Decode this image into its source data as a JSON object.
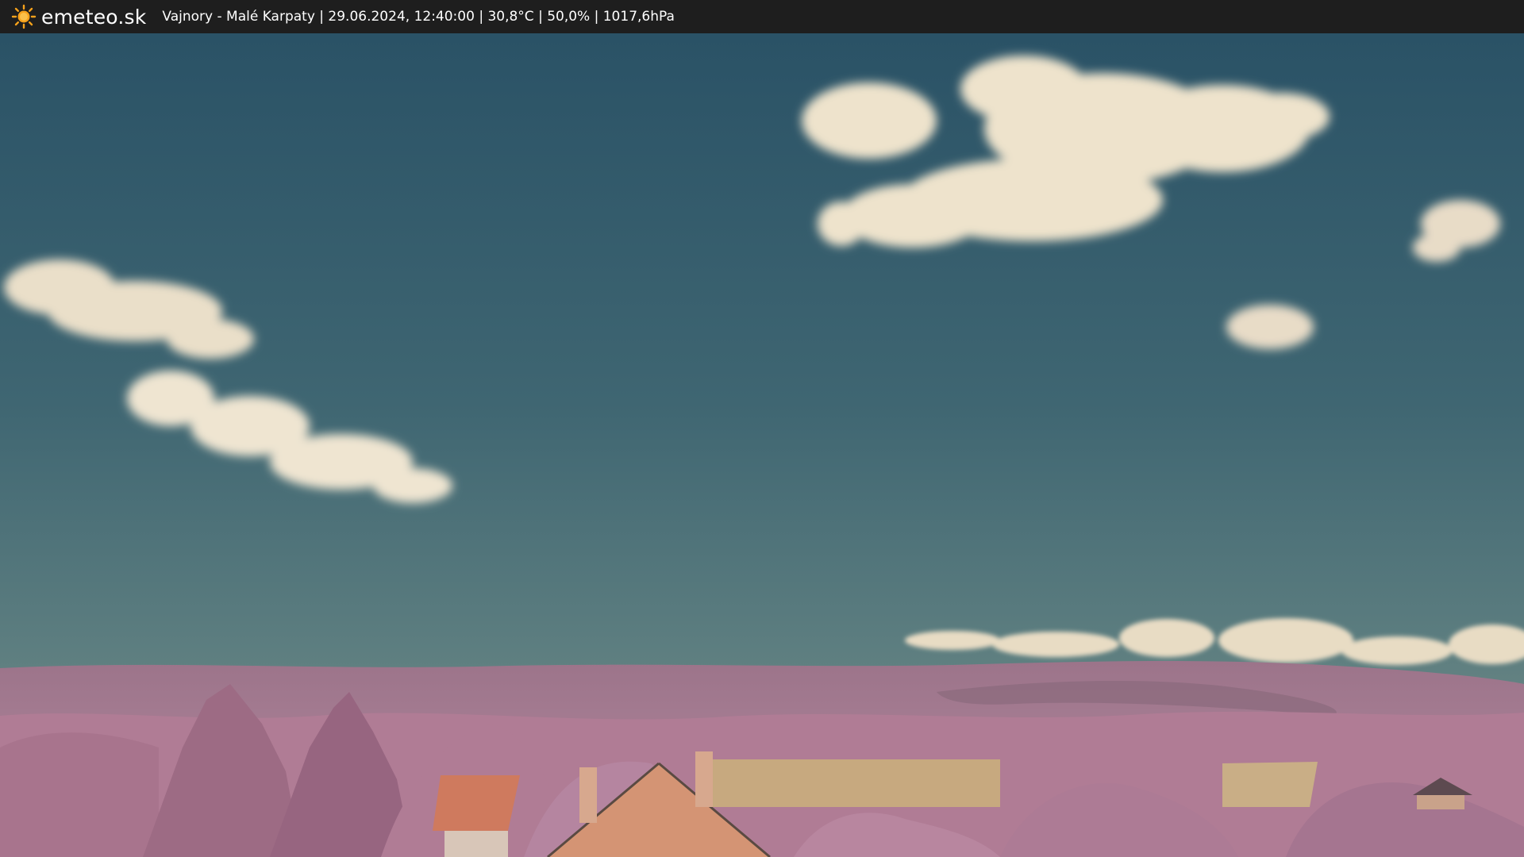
{
  "header": {
    "brand": "emeteo.sk",
    "logo_icon": "sun-icon",
    "station_info": "Vajnory - Malé Karpaty | 29.06.2024, 12:40:00 | 30,8°C | 50,0% | 1017,6hPa"
  },
  "colors": {
    "bar": "#1e1e1e",
    "sun": "#f7a21b",
    "sky_top": "#2d5569",
    "sky_horizon": "#6f8a86",
    "cloud": "#efe4cf",
    "foliage": "#b07c95",
    "roof": "#c97a60",
    "field": "#c8ab83"
  }
}
